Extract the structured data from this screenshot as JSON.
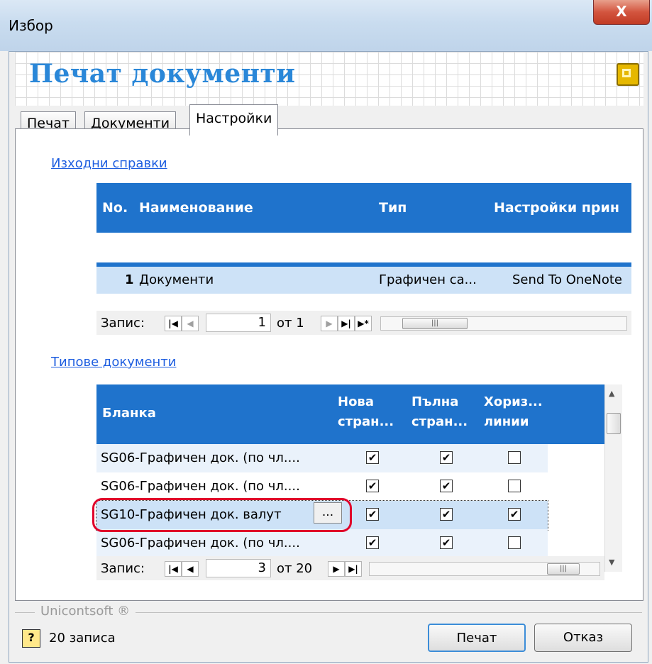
{
  "window": {
    "title": "Избор",
    "close_glyph": "X",
    "header_title": "Печат документи"
  },
  "tabs": [
    {
      "label": "Печат"
    },
    {
      "label": "Документи"
    },
    {
      "label": "Настройки",
      "active": true
    }
  ],
  "reports": {
    "section_label": "Изходни справки",
    "columns": [
      "No.",
      "Наименование",
      "Тип",
      "Настройки прин"
    ],
    "rows": [
      {
        "no": "1",
        "name": "Документи",
        "type": "Графичен са...",
        "printer": "Send To OneNote"
      }
    ],
    "navigator": {
      "label": "Запис:",
      "current": "1",
      "of_label": "от 1"
    }
  },
  "doc_types": {
    "section_label": "Типове документи",
    "columns": {
      "blank": "Бланка",
      "new_page_1": "Нова",
      "new_page_2": "стран...",
      "full_page_1": "Пълна",
      "full_page_2": "стран...",
      "horiz_1": "Хориз...",
      "horiz_2": "линии"
    },
    "rows": [
      {
        "name": "SG06-Графичен док. (по чл....",
        "new_page": "✔",
        "full_page": "✔",
        "horiz": ""
      },
      {
        "name": "SG06-Графичен док. (по чл....",
        "new_page": "✔",
        "full_page": "✔",
        "horiz": ""
      },
      {
        "name": "SG10-Графичен док. валут",
        "new_page": "✔",
        "full_page": "✔",
        "horiz": "✔"
      },
      {
        "name": "SG06-Графичен док. (по чл....",
        "new_page": "✔",
        "full_page": "✔",
        "horiz": ""
      }
    ],
    "ellipsis_button": "...",
    "navigator": {
      "label": "Запис:",
      "current": "3",
      "of_label": "от 20"
    }
  },
  "footer": {
    "brand": "Unicontsoft ®",
    "help_glyph": "?",
    "record_count": "20 записа",
    "print_button": "Печат",
    "cancel_button": "Отказ"
  },
  "colors": {
    "header_blue": "#1f73cc",
    "title_blue": "#2a87d8",
    "row_selected": "#cde2f7",
    "highlight_red": "#e0002a"
  },
  "icons": {
    "close": "close-icon",
    "logo": "app-logo-icon",
    "help": "help-icon",
    "nav_first": "first-record-icon",
    "nav_prev": "prev-record-icon",
    "nav_next": "next-record-icon",
    "nav_last": "last-record-icon",
    "nav_new": "new-record-icon"
  }
}
